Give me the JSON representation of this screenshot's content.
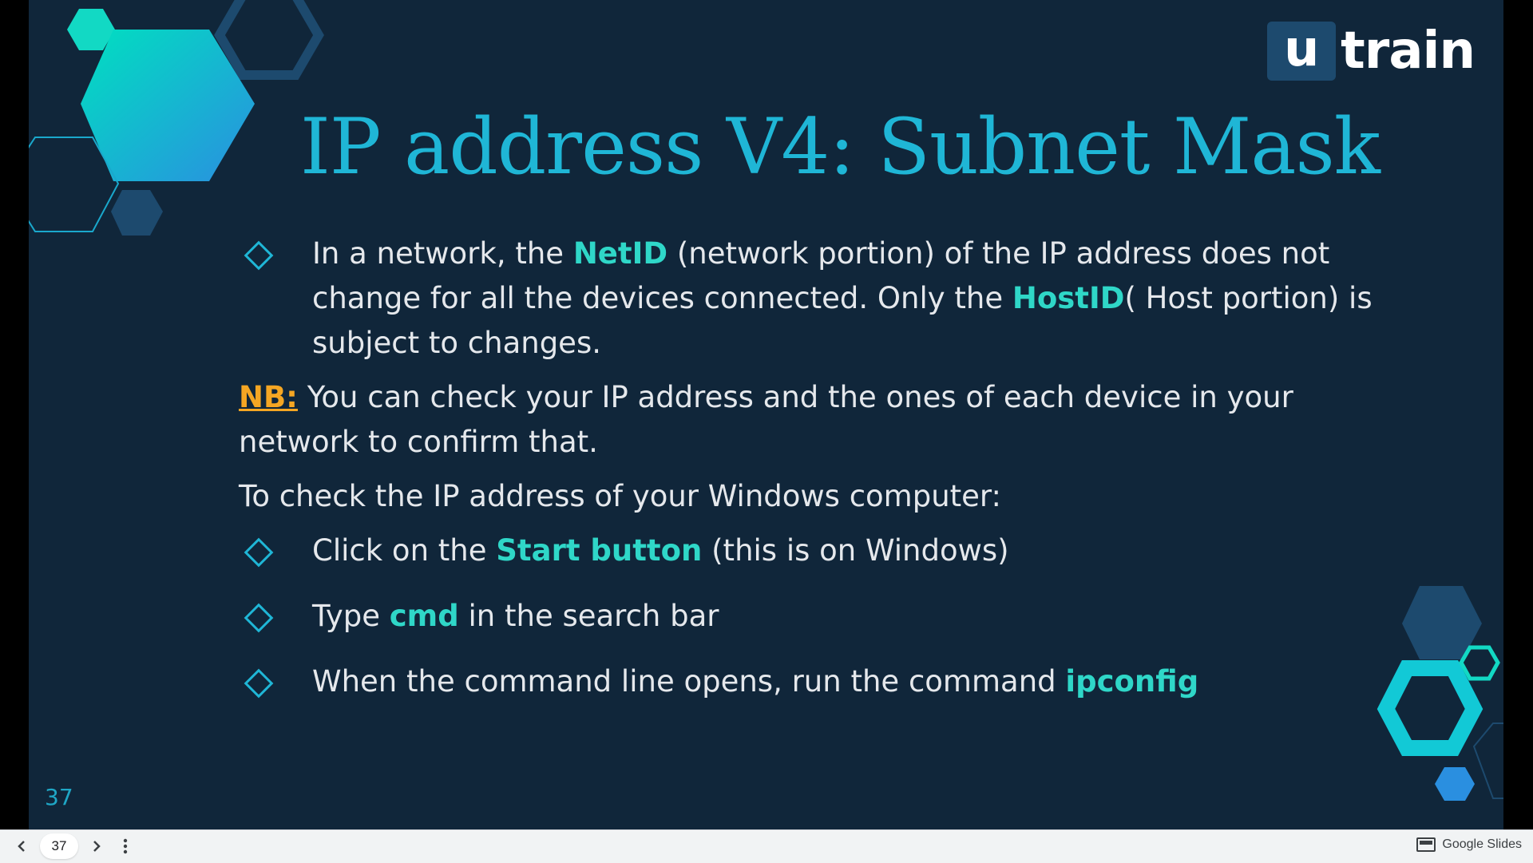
{
  "logo": {
    "u": "u",
    "train": "train"
  },
  "slide": {
    "title": "IP address V4: Subnet Mask",
    "bullet1": {
      "t1": "In a network, the ",
      "h1": "NetID",
      "t2": " (network portion) of the IP address does not change for all the devices connected. Only the ",
      "h2": "HostID",
      "t3": "( Host portion) is subject to changes."
    },
    "nb": {
      "label": "NB:",
      "text": " You can check your IP address and the ones of each device in your network to confirm that."
    },
    "check_intro": "To check the IP address of your Windows computer:",
    "steps": [
      {
        "pre": "Click on the ",
        "hl": "Start button",
        "post": " (this is on Windows)"
      },
      {
        "pre": "Type ",
        "hl": "cmd",
        "post": " in the search bar"
      },
      {
        "pre": "When the command line opens, run the command ",
        "hl": "ipconfig",
        "post": ""
      }
    ],
    "page_number": "37"
  },
  "toolbar": {
    "prev_icon": "chevron-left-icon",
    "page": "37",
    "next_icon": "chevron-right-icon",
    "menu_icon": "more-vert-icon",
    "app_label": "Google Slides"
  },
  "colors": {
    "background": "#10263a",
    "title": "#1fb6d6",
    "highlight": "#2fd7c8",
    "nb": "#f5a623",
    "text": "#e5e8ec"
  }
}
